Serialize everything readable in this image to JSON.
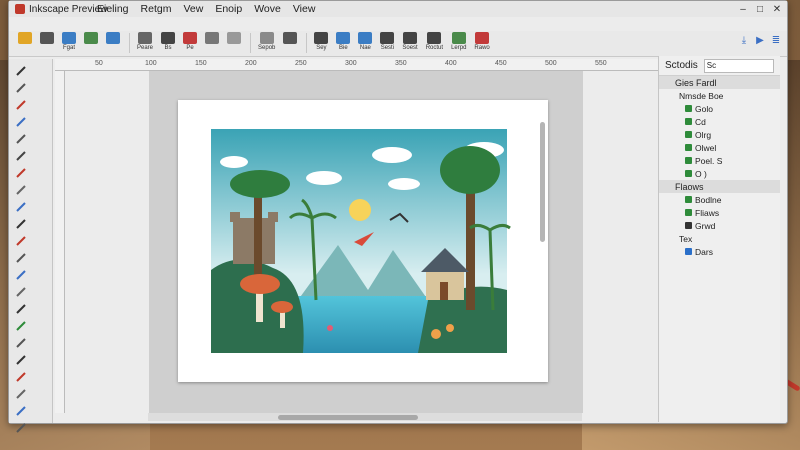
{
  "window": {
    "title": "Inkscape Preview"
  },
  "menu": [
    "Eieling",
    "Retgm",
    "Vew",
    "Enoip",
    "Wove",
    "View"
  ],
  "commands": [
    {
      "label": "",
      "color": "#e1a526"
    },
    {
      "label": "",
      "color": "#555"
    },
    {
      "label": "Fgat",
      "color": "#3b7dc4"
    },
    {
      "label": "",
      "color": "#4a8a4a"
    },
    {
      "label": "",
      "color": "#3b7dc4"
    },
    {
      "label": "Peare",
      "color": "#666"
    },
    {
      "label": "Bs",
      "color": "#444"
    },
    {
      "label": "Pe",
      "color": "#c23a3a"
    },
    {
      "label": "",
      "color": "#777"
    },
    {
      "label": "",
      "color": "#999"
    },
    {
      "label": "Sepob",
      "color": "#8a8a8a"
    },
    {
      "label": "",
      "color": "#555"
    },
    {
      "label": "Sey",
      "color": "#444"
    },
    {
      "label": "Bie",
      "color": "#3b7dc4"
    },
    {
      "label": "Nae",
      "color": "#3b7dc4"
    },
    {
      "label": "Sesti",
      "color": "#444"
    },
    {
      "label": "Soest",
      "color": "#444"
    },
    {
      "label": "Roctut",
      "color": "#444"
    },
    {
      "label": "Lerpd",
      "color": "#4a8a4a"
    },
    {
      "label": "Rawo",
      "color": "#c23a3a"
    }
  ],
  "right_icons": [
    "download-icon",
    "play-icon",
    "layers-icon"
  ],
  "ruler_labels": [
    "50",
    "100",
    "150",
    "200",
    "250",
    "300",
    "350",
    "400",
    "450",
    "500",
    "550"
  ],
  "panel": {
    "title": "Sctodis",
    "search_value": "Sc",
    "layers": [
      {
        "label": "Gies Fardl",
        "kind": "head"
      },
      {
        "label": "Nmsde Boe",
        "kind": "plain"
      },
      {
        "label": "Golo",
        "kind": "item",
        "color": "#2e8b3a"
      },
      {
        "label": "Cd",
        "kind": "item",
        "color": "#2e8b3a"
      },
      {
        "label": "Olrg",
        "kind": "item",
        "color": "#2e8b3a"
      },
      {
        "label": "Olwel",
        "kind": "item",
        "color": "#2e8b3a"
      },
      {
        "label": "Poel. S",
        "kind": "item",
        "color": "#2e8b3a"
      },
      {
        "label": "O )",
        "kind": "item",
        "color": "#2e8b3a"
      },
      {
        "label": "Flaows",
        "kind": "head2"
      },
      {
        "label": "Bodlne",
        "kind": "item",
        "color": "#2e8b3a"
      },
      {
        "label": "Fliaws",
        "kind": "item",
        "color": "#2e8b3a"
      },
      {
        "label": "Grwd",
        "kind": "item",
        "color": "#333"
      },
      {
        "label": "Tex",
        "kind": "plain"
      },
      {
        "label": "Dars",
        "kind": "item",
        "color": "#2a6fc9"
      }
    ]
  },
  "colors": {
    "sky_top": "#2f7f9a",
    "sky_bottom": "#cfeaf0",
    "water": "#3bb5d0",
    "sun": "#f7d35a"
  }
}
